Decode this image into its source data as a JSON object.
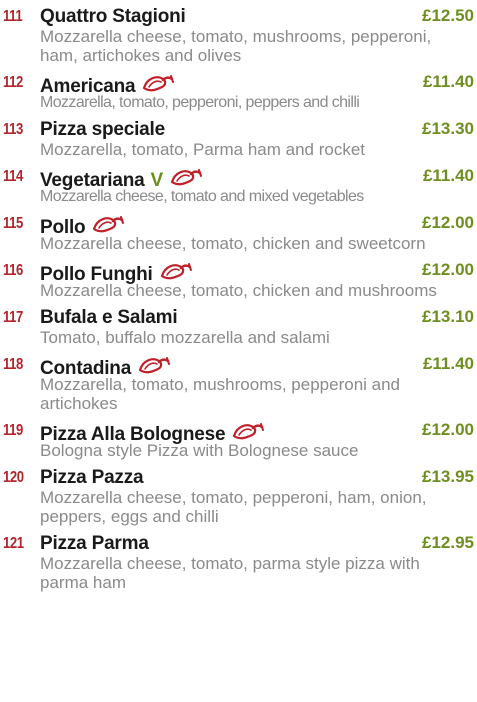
{
  "colors": {
    "number": "#b3242b",
    "name": "#1a1a1a",
    "price": "#6e8f1f",
    "description": "#8a8a8a",
    "vegetarian": "#6a8f1e",
    "chilli": "#c0202a"
  },
  "items": [
    {
      "num": "111",
      "name": "Quattro Stagioni",
      "price": "£12.50",
      "desc": "Mozzarella cheese, tomato, mushrooms, pepperoni, ham, artichokes and olives",
      "chilli": false,
      "veg": ""
    },
    {
      "num": "112",
      "name": "Americana",
      "price": "£11.40",
      "desc": "Mozzarella, tomato, pepperoni, peppers and chilli",
      "chilli": true,
      "veg": ""
    },
    {
      "num": "113",
      "name": "Pizza speciale",
      "price": "£13.30",
      "desc": "Mozzarella, tomato, Parma ham and rocket",
      "chilli": false,
      "veg": ""
    },
    {
      "num": "114",
      "name": "Vegetariana",
      "price": "£11.40",
      "desc": "Mozzarella cheese, tomato and mixed vegetables",
      "chilli": true,
      "veg": "V"
    },
    {
      "num": "115",
      "name": "Pollo",
      "price": "£12.00",
      "desc": "Mozzarella cheese, tomato, chicken and sweetcorn",
      "chilli": true,
      "veg": ""
    },
    {
      "num": "116",
      "name": "Pollo Funghi",
      "price": "£12.00",
      "desc": "Mozzarella cheese, tomato, chicken and mushrooms",
      "chilli": true,
      "veg": ""
    },
    {
      "num": "117",
      "name": "Bufala e Salami",
      "price": "£13.10",
      "desc": "Tomato, buffalo mozzarella and salami",
      "chilli": false,
      "veg": ""
    },
    {
      "num": "118",
      "name": "Contadina",
      "price": "£11.40",
      "desc": "Mozzarella, tomato, mushrooms, pepperoni and artichokes",
      "chilli": true,
      "veg": ""
    },
    {
      "num": "119",
      "name": "Pizza Alla Bolognese",
      "price": "£12.00",
      "desc": "Bologna style Pizza with Bolognese sauce",
      "chilli": true,
      "veg": ""
    },
    {
      "num": "120",
      "name": "Pizza Pazza",
      "price": "£13.95",
      "desc": "Mozzarella cheese, tomato, pepperoni, ham, onion, peppers, eggs and chilli",
      "chilli": false,
      "veg": ""
    },
    {
      "num": "121",
      "name": "Pizza Parma",
      "price": "£12.95",
      "desc": "Mozzarella cheese, tomato, parma style pizza with parma ham",
      "chilli": false,
      "veg": ""
    }
  ]
}
